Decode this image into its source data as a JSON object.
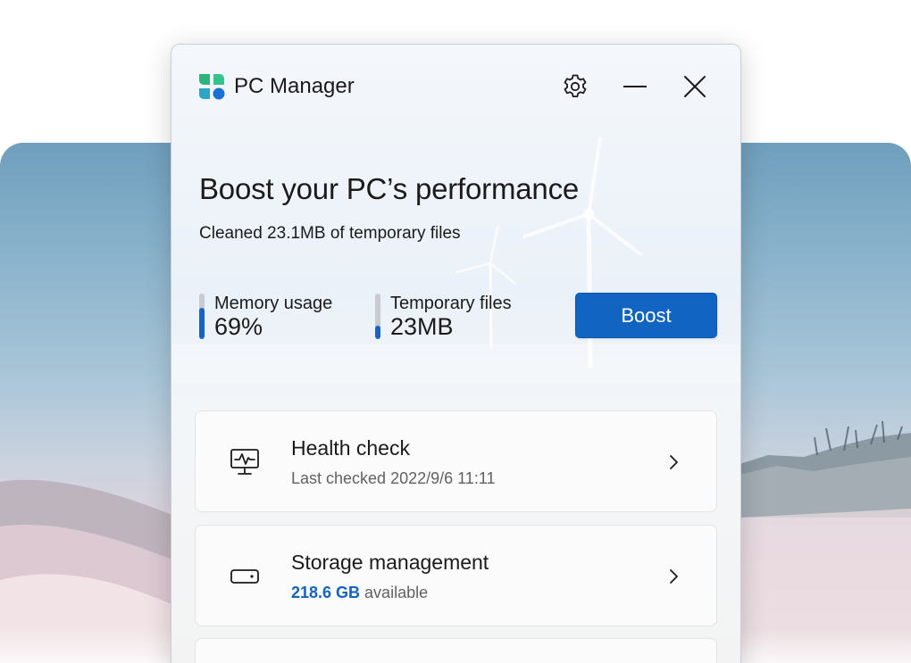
{
  "app": {
    "title": "PC Manager",
    "logo_icon": "pc-manager-logo-icon",
    "accent_color": "#1264c3"
  },
  "titlebar": {
    "settings_icon": "gear-icon",
    "minimize_icon": "minimize-icon",
    "close_icon": "close-icon"
  },
  "hero": {
    "headline": "Boost your PC’s performance",
    "subline": "Cleaned 23.1MB of temporary files"
  },
  "metrics": {
    "memory": {
      "label": "Memory usage",
      "value": "69%",
      "fill_fraction": 0.69
    },
    "temp_files": {
      "label": "Temporary files",
      "value": "23MB",
      "fill_fraction": 0.3
    }
  },
  "boost_button": {
    "label": "Boost"
  },
  "cards": {
    "health": {
      "icon": "health-monitor-icon",
      "title": "Health check",
      "subtitle": "Last checked 2022/9/6 11:11"
    },
    "storage": {
      "icon": "storage-drive-icon",
      "title": "Storage management",
      "subtitle_highlight": "218.6 GB",
      "subtitle_rest": " available"
    }
  }
}
